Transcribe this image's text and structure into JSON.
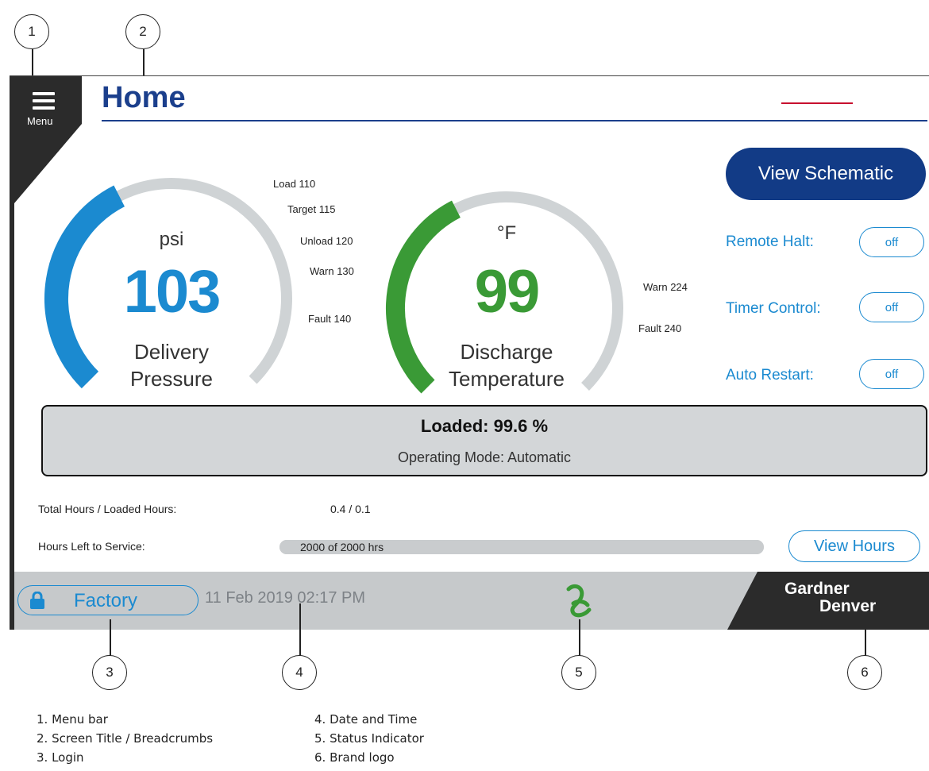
{
  "callouts": [
    "1",
    "2",
    "3",
    "4",
    "5",
    "6"
  ],
  "menu": {
    "label": "Menu"
  },
  "header": {
    "title": "Home"
  },
  "pressure_gauge": {
    "unit": "psi",
    "value": "103",
    "label_line1": "Delivery",
    "label_line2": "Pressure",
    "color": "#1b8ad0",
    "fill_fraction": 0.4,
    "ticks": [
      "Load 110",
      "Target 115",
      "Unload 120",
      "Warn 130",
      "Fault 140"
    ]
  },
  "temperature_gauge": {
    "unit": "°F",
    "value": "99",
    "label_line1": "Discharge",
    "label_line2": "Temperature",
    "color": "#3a9a36",
    "fill_fraction": 0.4,
    "ticks": [
      "Warn 224",
      "Fault 240"
    ]
  },
  "actions": {
    "view_schematic": "View Schematic",
    "view_hours": "View Hours"
  },
  "toggles": [
    {
      "label": "Remote Halt:",
      "state": "off"
    },
    {
      "label": "Timer Control:",
      "state": "off"
    },
    {
      "label": "Auto Restart:",
      "state": "off"
    }
  ],
  "status": {
    "loaded": "Loaded: 99.6 %",
    "mode": "Operating Mode: Automatic"
  },
  "hours": {
    "total_label": "Total Hours / Loaded Hours:",
    "total_value": "0.4 / 0.1",
    "service_label": "Hours Left to Service:",
    "service_value": "2000 of 2000 hrs",
    "service_fraction": 1.0
  },
  "footer": {
    "login_user": "Factory",
    "datetime": "11 Feb 2019  02:17 PM",
    "brand_line1": "Gardner",
    "brand_line2": "Denver"
  },
  "legend": [
    "1. Menu bar",
    "2. Screen Title / Breadcrumbs",
    "3. Login",
    "4. Date and Time",
    "5. Status Indicator",
    "6. Brand logo"
  ],
  "colors": {
    "accent_blue": "#1b8ad0",
    "dark_blue": "#123b86",
    "title_blue": "#1b3f8c",
    "green": "#3a9a36",
    "gauge_track": "#cfd3d5",
    "bar_gray": "#c6c9cb"
  }
}
